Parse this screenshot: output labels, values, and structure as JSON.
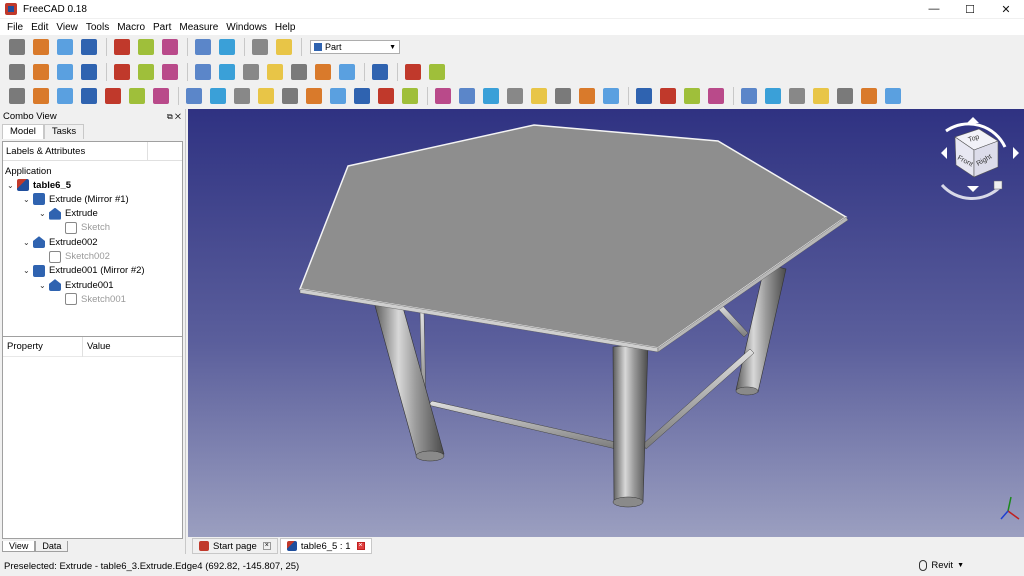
{
  "window": {
    "title": "FreeCAD 0.18",
    "minimize": "—",
    "maximize": "☐",
    "close": "✕"
  },
  "menu": [
    "File",
    "Edit",
    "View",
    "Tools",
    "Macro",
    "Part",
    "Measure",
    "Windows",
    "Help"
  ],
  "workbench": {
    "selected": "Part"
  },
  "toolbar_icons": {
    "row1": [
      "new-file-icon",
      "open-file-icon",
      "save-icon",
      "save-as-icon",
      "cut-icon",
      "copy-icon",
      "paste-icon",
      "undo-icon",
      "redo-icon",
      "refresh-icon",
      "whats-this-icon"
    ],
    "row2": [
      "record-macro-icon",
      "stop-macro-icon",
      "edit-macro-icon",
      "run-macro-icon",
      "fit-all-icon",
      "fit-selection-icon",
      "draw-style-icon",
      "isometric-view-icon",
      "front-view-icon",
      "top-view-icon",
      "right-view-icon",
      "rear-view-icon",
      "bottom-view-icon",
      "left-view-icon",
      "measure-icon",
      "part-icon",
      "group-icon"
    ],
    "row3": [
      "box-icon",
      "cylinder-icon",
      "sphere-icon",
      "cone-icon",
      "torus-icon",
      "primitives-icon",
      "shape-builder-icon",
      "extrude-icon",
      "revolve-icon",
      "mirror-icon",
      "fillet-icon",
      "chamfer-icon",
      "make-face-icon",
      "ruled-surface-icon",
      "loft-icon",
      "sweep-icon",
      "section-icon",
      "compound-icon",
      "boolean-icon",
      "cut-icon",
      "fuse-icon",
      "common-icon",
      "join-icon",
      "split-icon",
      "check-geometry-icon",
      "defeaturing-icon",
      "thickness-icon",
      "projection-icon",
      "offset-icon",
      "measure-linear-icon",
      "measure-angular-icon",
      "measure-refresh-icon",
      "measure-clear-icon",
      "toggle-all-icon",
      "toggle-3d-icon",
      "toggle-delta-icon"
    ]
  },
  "combo": {
    "title": "Combo View",
    "tabs": {
      "model": "Model",
      "tasks": "Tasks"
    },
    "tree_header": "Labels & Attributes",
    "application": "Application",
    "tree": [
      {
        "label": "table6_5",
        "level": 0,
        "icon": "document-icon",
        "bold": true,
        "expanded": true
      },
      {
        "label": "Extrude (Mirror #1)",
        "level": 1,
        "icon": "mirror-icon",
        "expanded": true
      },
      {
        "label": "Extrude",
        "level": 2,
        "icon": "extrude-icon",
        "expanded": true
      },
      {
        "label": "Sketch",
        "level": 3,
        "icon": "sketch-icon",
        "gray": true
      },
      {
        "label": "Extrude002",
        "level": 1,
        "icon": "extrude-icon",
        "expanded": true
      },
      {
        "label": "Sketch002",
        "level": 2,
        "icon": "sketch-icon",
        "gray": true
      },
      {
        "label": "Extrude001 (Mirror #2)",
        "level": 1,
        "icon": "mirror-icon",
        "expanded": true
      },
      {
        "label": "Extrude001",
        "level": 2,
        "icon": "extrude-icon",
        "expanded": true
      },
      {
        "label": "Sketch001",
        "level": 3,
        "icon": "sketch-icon",
        "gray": true
      }
    ],
    "property_header": {
      "property": "Property",
      "value": "Value"
    },
    "bottom_tabs": {
      "view": "View",
      "data": "Data"
    }
  },
  "navcube": {
    "top": "Top",
    "front": "Front",
    "right": "Right"
  },
  "view_tabs": [
    {
      "label": "Start page",
      "icon": "start-page-icon",
      "active": false
    },
    {
      "label": "table6_5 : 1",
      "icon": "document-icon",
      "active": true
    }
  ],
  "status": {
    "text": "Preselected: Extrude - table6_3.Extrude.Edge4 (692.82, -145.807, 25)",
    "nav_style": "Revit"
  },
  "colors": {
    "bg_top": "#2f3282",
    "bg_bottom": "#9b9fc0",
    "tabletop": "#8e8e8e",
    "accent_red": "#c0392b",
    "accent_blue": "#2f63b0"
  }
}
